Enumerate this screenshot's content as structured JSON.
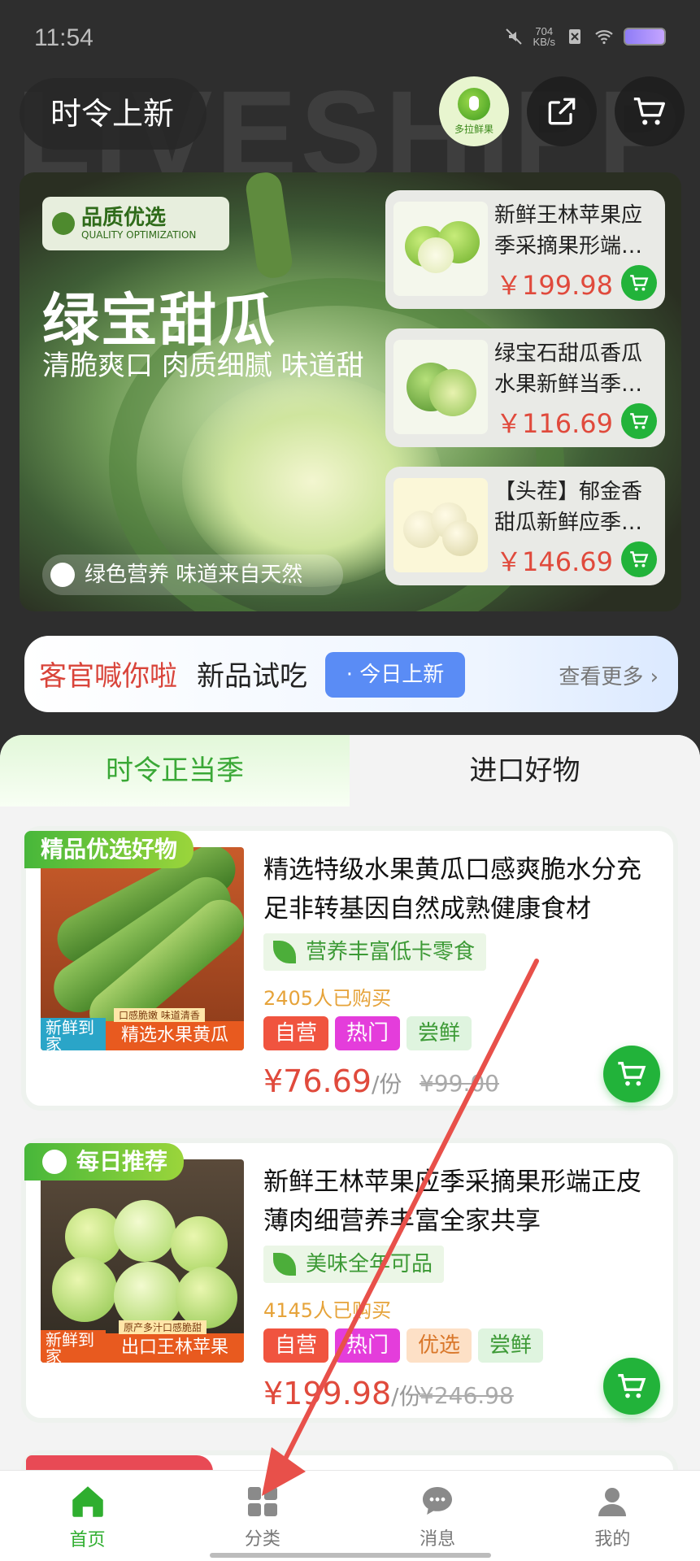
{
  "status_bar": {
    "time": "11:54",
    "net_speed": "704",
    "net_unit": "KB/s"
  },
  "header": {
    "title": "时令上新",
    "logo_text": "多拉鲜果"
  },
  "banner": {
    "bg_word": "LIVESHIPP",
    "quality_label": "品质优选",
    "quality_sub": "QUALITY OPTIMIZATION",
    "title": "绿宝甜瓜",
    "subtitle": "清脆爽口 肉质细腻 味道甜",
    "bottom_text": "绿色营养 味道来自天然",
    "products": [
      {
        "name": "新鲜王林苹果应季采摘果形端…",
        "price": "￥199.98"
      },
      {
        "name": "绿宝石甜瓜香瓜水果新鲜当季…",
        "price": "￥116.69"
      },
      {
        "name": "【头茬】郁金香甜瓜新鲜应季…",
        "price": "￥146.69"
      }
    ]
  },
  "promo": {
    "red_text": "客官喊你啦",
    "text": "新品试吃",
    "pill": "· 今日上新",
    "more": "查看更多"
  },
  "tabs": [
    {
      "label": "时令正当季"
    },
    {
      "label": "进口好物"
    }
  ],
  "products": [
    {
      "ribbon": "精品优选好物",
      "img_caption_left": "新鲜到家",
      "img_caption_right": "精选水果黄瓜",
      "img_small": "口感脆嫩 味道清香",
      "title": "精选特级水果黄瓜口感爽脆水分充足非转基因自然成熟健康食材",
      "feature": "营养丰富低卡零食",
      "sold": "2405人已购买",
      "tags": [
        "自营",
        "热门",
        "尝鲜"
      ],
      "price": "¥76.69",
      "unit": "/份",
      "original": "¥99.00"
    },
    {
      "ribbon": "每日推荐",
      "img_caption_left": "新鲜到家",
      "img_caption_right": "出口王林苹果",
      "img_small": "原产多汁口感脆甜",
      "title": "新鲜王林苹果应季采摘果形端正皮薄肉细营养丰富全家共享",
      "feature": "美味全年可品",
      "sold": "4145人已购买",
      "tags": [
        "自营",
        "热门",
        "优选",
        "尝鲜"
      ],
      "price": "¥199.98",
      "unit": "/份",
      "original": "¥246.98"
    }
  ],
  "nav": [
    {
      "label": "首页",
      "icon": "home-icon",
      "active": true
    },
    {
      "label": "分类",
      "icon": "grid-icon",
      "active": false
    },
    {
      "label": "消息",
      "icon": "chat-icon",
      "active": false
    },
    {
      "label": "我的",
      "icon": "person-icon",
      "active": false
    }
  ],
  "colors": {
    "accent_green": "#22b33a",
    "price_red": "#e04a3c",
    "tag_self": "#f0543f",
    "tag_hot": "#e43ddb",
    "tag_pick": "#fde0c6",
    "tag_new": "#dff4df"
  }
}
